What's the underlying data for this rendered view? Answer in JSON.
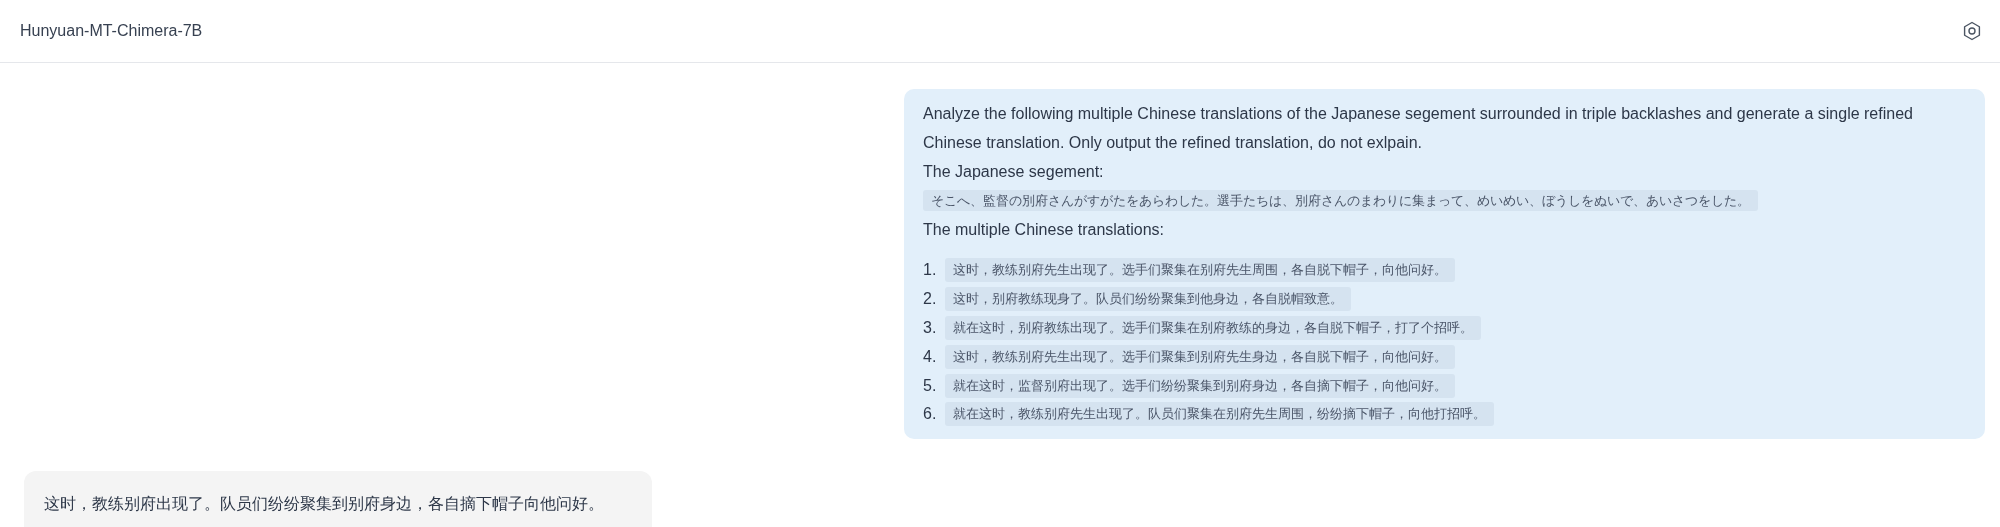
{
  "header": {
    "title": "Hunyuan-MT-Chimera-7B"
  },
  "user_message": {
    "paragraphs": [
      "Analyze the following multiple Chinese translations of the Japanese segement surrounded in triple backlashes and generate a single refined Chinese translation. Only output the refined translation, do not exlpain.",
      "The Japanese segement:"
    ],
    "segment": "そこへ、監督の別府さんがすがたをあらわした。選手たちは、別府さんのまわりに集まって、めいめい、ぼうしをぬいで、あいさつをした。",
    "list_heading": "The multiple Chinese translations:",
    "translations": [
      {
        "number": "1.",
        "text": "这时，教练别府先生出现了。选手们聚集在别府先生周围，各自脱下帽子，向他问好。"
      },
      {
        "number": "2.",
        "text": "这时，别府教练现身了。队员们纷纷聚集到他身边，各自脱帽致意。"
      },
      {
        "number": "3.",
        "text": "就在这时，别府教练出现了。选手们聚集在别府教练的身边，各自脱下帽子，打了个招呼。"
      },
      {
        "number": "4.",
        "text": "这时，教练别府先生出现了。选手们聚集到别府先生身边，各自脱下帽子，向他问好。"
      },
      {
        "number": "5.",
        "text": "就在这时，监督别府出现了。选手们纷纷聚集到别府身边，各自摘下帽子，向他问好。"
      },
      {
        "number": "6.",
        "text": "就在这时，教练别府先生出现了。队员们聚集在别府先生周围，纷纷摘下帽子，向他打招呼。"
      }
    ]
  },
  "assistant_message": {
    "text": "这时，教练别府出现了。队员们纷纷聚集到别府身边，各自摘下帽子向他问好。"
  }
}
